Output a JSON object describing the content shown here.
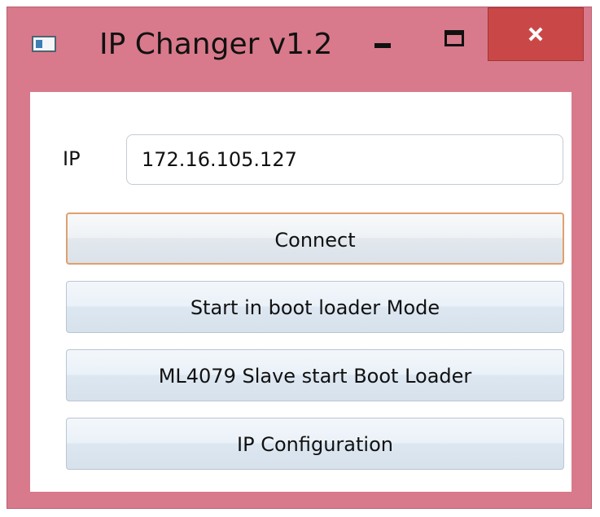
{
  "window": {
    "title": "IP Changer v1.2"
  },
  "ip": {
    "label": "IP",
    "value": "172.16.105.127"
  },
  "buttons": {
    "connect": "Connect",
    "boot_loader_mode": "Start in boot loader Mode",
    "slave_boot_loader": "ML4079 Slave start Boot Loader",
    "ip_configuration": "IP Configuration"
  },
  "colors": {
    "window_frame": "#d87a8b",
    "close_button": "#c94847",
    "default_button_border": "#e0a06d"
  },
  "icons": {
    "app": "app-window-icon",
    "minimize": "minimize-icon",
    "maximize": "maximize-icon",
    "close": "close-icon"
  }
}
